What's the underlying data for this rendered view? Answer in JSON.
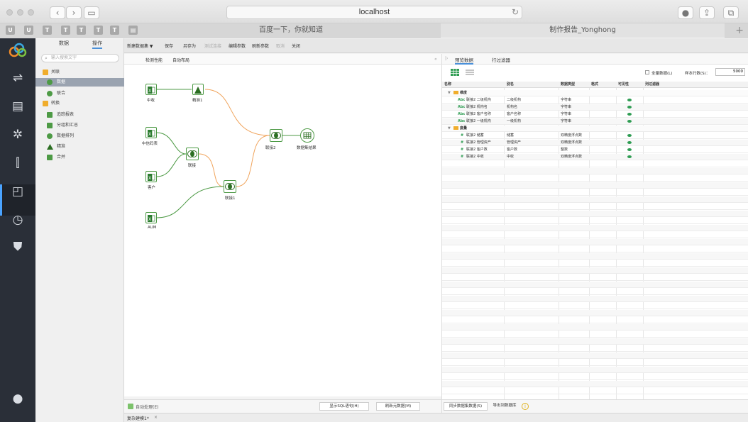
{
  "browser": {
    "url": "localhost",
    "tabs": [
      {
        "label": "百度一下，你就知道"
      },
      {
        "label": "制作报告_Yonghong"
      }
    ]
  },
  "sidebar": {
    "tabs": [
      {
        "label": "数据"
      },
      {
        "label": "操作"
      }
    ],
    "search_placeholder": "输入搜索文字",
    "items": [
      {
        "label": "关联",
        "icon": "folder-icon",
        "color": "#f0ad2c"
      },
      {
        "label": "数据",
        "icon": "join-icon",
        "color": "#4d9a45"
      },
      {
        "label": "联合",
        "icon": "union-icon",
        "color": "#4d9a45"
      },
      {
        "label": "转换",
        "icon": "folder-icon",
        "color": "#f0ad2c"
      },
      {
        "label": "追踪报表",
        "icon": "trace-icon",
        "color": "#4d9a45"
      },
      {
        "label": "分组和汇总",
        "icon": "group-icon",
        "color": "#4d9a45"
      },
      {
        "label": "数据排列",
        "icon": "sort-icon",
        "color": "#4d9a45"
      },
      {
        "label": "精准",
        "icon": "triangle-icon",
        "color": "#2b6e22"
      },
      {
        "label": "合并",
        "icon": "merge-icon",
        "color": "#4d9a45"
      }
    ]
  },
  "toolbar": {
    "items": [
      {
        "label": "新建数据集 ▼",
        "enabled": true
      },
      {
        "label": "保存",
        "enabled": true
      },
      {
        "label": "另存为",
        "enabled": true
      },
      {
        "label": "测试连接",
        "enabled": false
      },
      {
        "label": "编辑参数",
        "enabled": true
      },
      {
        "label": "刷新参数",
        "enabled": true
      },
      {
        "label": "取消",
        "enabled": false
      },
      {
        "label": "关闭",
        "enabled": true
      }
    ]
  },
  "canvas": {
    "header": {
      "check_perf": "检测性能",
      "auto_layout": "自动布局"
    },
    "nodes": [
      {
        "label": "中收",
        "kind": "excel"
      },
      {
        "label": "精准1",
        "kind": "filter"
      },
      {
        "label": "中信码表",
        "kind": "excel"
      },
      {
        "label": "联接",
        "kind": "join"
      },
      {
        "label": "客户",
        "kind": "excel"
      },
      {
        "label": "联接1",
        "kind": "join"
      },
      {
        "label": "AUM",
        "kind": "excel"
      },
      {
        "label": "联接2",
        "kind": "join"
      },
      {
        "label": "数据集结果",
        "kind": "result"
      }
    ],
    "footer": {
      "auto_process": "自动处理(E)",
      "show_sql": "显示SQL语句(H)",
      "refresh_meta": "刷新元数据(M)"
    }
  },
  "bottom_tab": {
    "label": "复杂建模1*",
    "close": "×"
  },
  "right_panel": {
    "tabs": [
      {
        "label": "预览数据"
      },
      {
        "label": "行过滤器"
      }
    ],
    "all_data_label": "全量数据(L)",
    "sample_rows_label": "样本行数(S)：",
    "sample_rows_value": "5000",
    "columns": [
      "名称",
      "别名",
      "数据类型",
      "格式",
      "可见性",
      "列过滤器"
    ],
    "rows": [
      {
        "type": "group",
        "name": "维度"
      },
      {
        "type": "dim",
        "prefix": "Abc",
        "name": "联接2 二级机构",
        "alias": "二级机构",
        "dtype": "字符串",
        "visible": true
      },
      {
        "type": "dim",
        "prefix": "Abc",
        "name": "联接2 机构名",
        "alias": "机构名",
        "dtype": "字符串",
        "visible": true
      },
      {
        "type": "dim",
        "prefix": "Abc",
        "name": "联接2 客户名称",
        "alias": "客户名称",
        "dtype": "字符串",
        "visible": true
      },
      {
        "type": "dim",
        "prefix": "Abc",
        "name": "联接2 一级机构",
        "alias": "一级机构",
        "dtype": "字符串",
        "visible": true
      },
      {
        "type": "group",
        "name": "度量"
      },
      {
        "type": "measure",
        "prefix": "#",
        "name": "联接2 储蓄",
        "alias": "储蓄",
        "dtype": "双精度浮点数",
        "visible": true
      },
      {
        "type": "measure",
        "prefix": "#",
        "name": "联接2 管理资产",
        "alias": "管理资产",
        "dtype": "双精度浮点数",
        "visible": true
      },
      {
        "type": "measure",
        "prefix": "#",
        "name": "联接2 客户数",
        "alias": "客户数",
        "dtype": "整数",
        "visible": true
      },
      {
        "type": "measure",
        "prefix": "#",
        "name": "联接2 中收",
        "alias": "中收",
        "dtype": "双精度浮点数",
        "visible": true
      }
    ],
    "footer": {
      "sync_btn": "同步数据集数据(S)",
      "export_btn": "导出到数据库"
    }
  }
}
